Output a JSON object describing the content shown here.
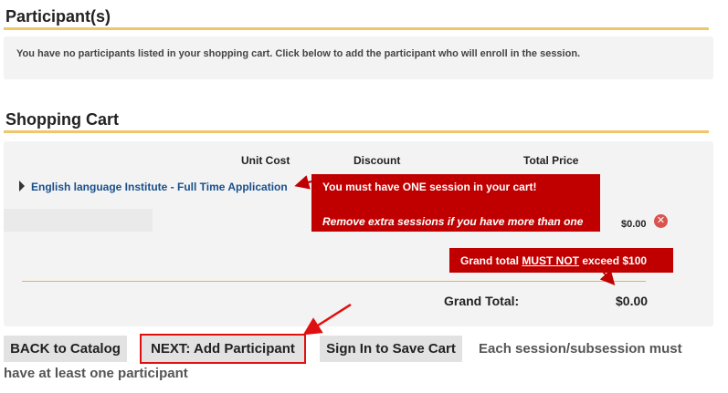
{
  "participants": {
    "title": "Participant(s)",
    "notice": "You have no participants listed in your shopping cart. Click below to add the participant who will enroll in the session."
  },
  "cart": {
    "title": "Shopping Cart",
    "columns": {
      "unit_cost": "Unit Cost",
      "discount": "Discount",
      "total_price": "Total Price"
    },
    "item": {
      "name": "English language Institute - Full Time Application",
      "price": "$0.00",
      "remove_icon": "remove-icon"
    },
    "grand_total_label": "Grand Total:",
    "grand_total_value": "$0.00"
  },
  "callouts": {
    "one_session_line1": "You must have ONE session in your cart!",
    "one_session_line2": "Remove extra sessions if you have more than one",
    "grand_total_pre": "Grand total ",
    "grand_total_em": "MUST NOT",
    "grand_total_post": " exceed $100",
    "color": "#c00000"
  },
  "buttons": {
    "back": "BACK to Catalog",
    "next": "NEXT: Add Participant",
    "sign_in": "Sign In to Save Cart"
  },
  "footer_note_line1": "Each session/subsession must",
  "footer_note_line2": "have at least one participant",
  "colors": {
    "accent_rule": "#f0c66a",
    "link": "#1a4f8b",
    "highlight": "#e01010"
  }
}
